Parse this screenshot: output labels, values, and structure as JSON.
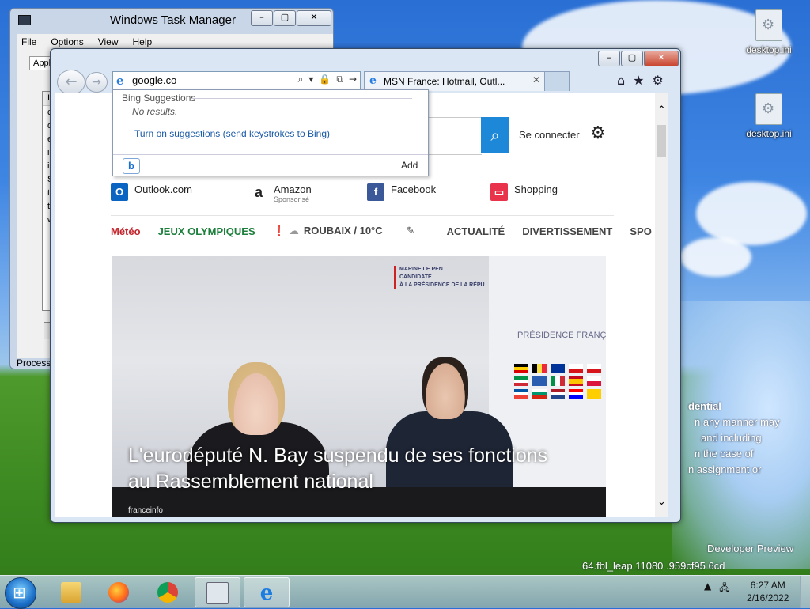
{
  "desktop": {
    "icons": [
      {
        "label": "desktop.ini"
      },
      {
        "label": "desktop.ini"
      }
    ],
    "watermark": [
      "dential",
      "n any manner may",
      "and including",
      "n the case of",
      "n assignment or",
      "Developer Preview",
      "64.fbl_leap.11080 .959cf95 6cd"
    ]
  },
  "task_manager": {
    "title": "Windows Task Manager",
    "menu": [
      "File",
      "Options",
      "View",
      "Help"
    ],
    "tab": "Applica",
    "list_header": "Ima",
    "list_items": [
      "csr",
      "dw",
      "exp",
      "iex",
      "iex",
      "Sea",
      "tas",
      "tas",
      "win"
    ],
    "status": "Processe"
  },
  "ie": {
    "address_value": "google.co",
    "tab_title": "MSN France: Hotmail, Outl...",
    "dropdown": {
      "header": "Bing Suggestions",
      "no_results": "No results.",
      "turn_on": "Turn on suggestions (send keystrokes to Bing)",
      "add": "Add",
      "bing_logo": "b"
    }
  },
  "msn": {
    "connect": "Se connecter",
    "links": [
      {
        "label": "Outlook.com",
        "sub": "",
        "icon": "outlook-icon",
        "color": "#0a64c2"
      },
      {
        "label": "Amazon",
        "sub": "Sponsorisé",
        "icon": "amazon-icon",
        "color": "#222222"
      },
      {
        "label": "Facebook",
        "sub": "",
        "icon": "facebook-icon",
        "color": "#3b5998"
      },
      {
        "label": "Shopping",
        "sub": "",
        "icon": "shopping-bag-icon",
        "color": "#e8334a"
      }
    ],
    "nav": {
      "meteo": "Météo",
      "jo": "JEUX OLYMPIQUES",
      "weather": "ROUBAIX / 10°C",
      "actualite": "ACTUALITÉ",
      "divertissement": "DIVERTISSEMENT",
      "sport": "SPO"
    },
    "hero": {
      "banner": [
        "MARINE LE PEN",
        "CANDIDATE",
        "À LA PRÉSIDENCE DE LA RÉPU"
      ],
      "backdrop": "PRÉSIDENCE FRANÇ",
      "caption": "L'eurodéputé N. Bay suspendu de ses fonctions au Rassemblement national",
      "credit": "franceinfo"
    }
  },
  "taskbar": {
    "time": "6:27 AM",
    "date": "2/16/2022"
  },
  "colors": {
    "meteo_red": "#c4262e",
    "jo_green": "#1d7f3c",
    "nav_gray": "#444444",
    "search_blue": "#1e88d8"
  }
}
